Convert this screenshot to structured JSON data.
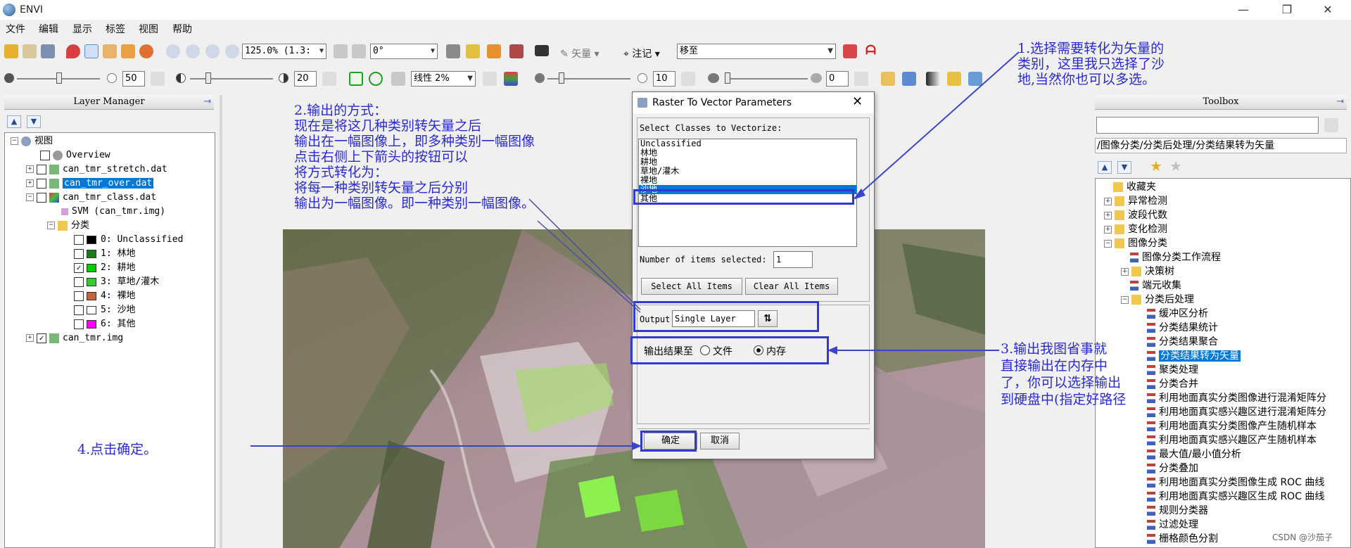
{
  "window": {
    "title": "ENVI",
    "controls": [
      "—",
      "❐",
      "✕"
    ]
  },
  "menu": [
    "文件",
    "编辑",
    "显示",
    "标签",
    "视图",
    "帮助"
  ],
  "toolbar1": {
    "zoom_value": "125.0% (1.3:",
    "rotation_value": "0°",
    "vector_label": "矢量",
    "annotation_label": "注记",
    "goto_value": "移至"
  },
  "toolbar2": {
    "brightness_value": "50",
    "contrast_value": "20",
    "stretch_value": "线性 2%",
    "sharpen_value": "10",
    "transparency_value": "0"
  },
  "layer_manager": {
    "title": "Layer Manager",
    "root_label": "视图",
    "items": [
      {
        "label": "Overview"
      },
      {
        "label": "can_tmr_stretch.dat"
      },
      {
        "label": "can_tmr_over.dat"
      },
      {
        "label": "can_tmr_class.dat"
      },
      {
        "label": "SVM (can_tmr.img)"
      },
      {
        "label": "分类"
      }
    ],
    "classes": [
      {
        "label": "0: Unclassified",
        "color": "#000000",
        "checked": false
      },
      {
        "label": "1: 林地",
        "color": "#1a7d1a",
        "checked": false
      },
      {
        "label": "2: 耕地",
        "color": "#00cc00",
        "checked": true
      },
      {
        "label": "3: 草地/灌木",
        "color": "#33cc33",
        "checked": false
      },
      {
        "label": "4: 裸地",
        "color": "#c8643c",
        "checked": false
      },
      {
        "label": "5: 沙地",
        "color": "#ffffff",
        "checked": false
      },
      {
        "label": "6: 其他",
        "color": "#ff00ff",
        "checked": false
      }
    ],
    "bottom_item": "can_tmr.img"
  },
  "dialog": {
    "title": "Raster To Vector Parameters",
    "select_label": "Select Classes to Vectorize:",
    "classes": [
      "Unclassified",
      "林地",
      "耕地",
      "草地/灌木",
      "裸地",
      "沙地",
      "其他"
    ],
    "selected_index": 5,
    "items_selected_label": "Number of items selected:",
    "items_selected_value": "1",
    "select_all": "Select All Items",
    "clear_all": "Clear All Items",
    "output_label": "Output",
    "output_value": "Single Layer",
    "output_to_label": "输出结果至",
    "radio_file": "文件",
    "radio_memory": "内存",
    "ok": "确定",
    "cancel": "取消"
  },
  "toolbox": {
    "title": "Toolbox",
    "path": "/图像分类/分类后处理/分类结果转为矢量",
    "items": [
      "收藏夹",
      "异常检测",
      "波段代数",
      "变化检测",
      "图像分类",
      "图像分类工作流程",
      "决策树",
      "端元收集",
      "分类后处理",
      "缓冲区分析",
      "分类结果统计",
      "分类结果聚合",
      "分类结果转为矢量",
      "聚类处理",
      "分类合并",
      "利用地面真实分类图像进行混淆矩阵分",
      "利用地面真实感兴趣区进行混淆矩阵分",
      "利用地面真实分类图像产生随机样本",
      "利用地面真实感兴趣区产生随机样本",
      "最大值/最小值分析",
      "分类叠加",
      "利用地面真实分类图像生成 ROC 曲线",
      "利用地面真实感兴趣区生成 ROC 曲线",
      "规则分类器",
      "过滤处理",
      "栅格颜色分割"
    ]
  },
  "annotations": {
    "note1": [
      "1.选择需要转化为矢量的",
      "类别，这里我只选择了沙",
      "地,当然你也可以多选。"
    ],
    "note2": [
      "2.输出的方式：",
      "现在是将这几种类别转矢量之后",
      "输出在一幅图像上，即多种类别一幅图像",
      "点击右侧上下箭头的按钮可以",
      "将方式转化为：",
      "将每一种类别转矢量之后分别",
      "输出为一幅图像。即一种类别一幅图像。"
    ],
    "note3": [
      "3.输出我图省事就",
      "直接输出在内存中",
      "了，你可以选择输出",
      "到硬盘中(指定好路径"
    ],
    "note4": "4.点击确定。",
    "watermark": "CSDN @沙茄子"
  },
  "colors": {
    "annotation": "#2a2ad0",
    "highlight": "#2f3bd0",
    "selection": "#0078d7"
  }
}
